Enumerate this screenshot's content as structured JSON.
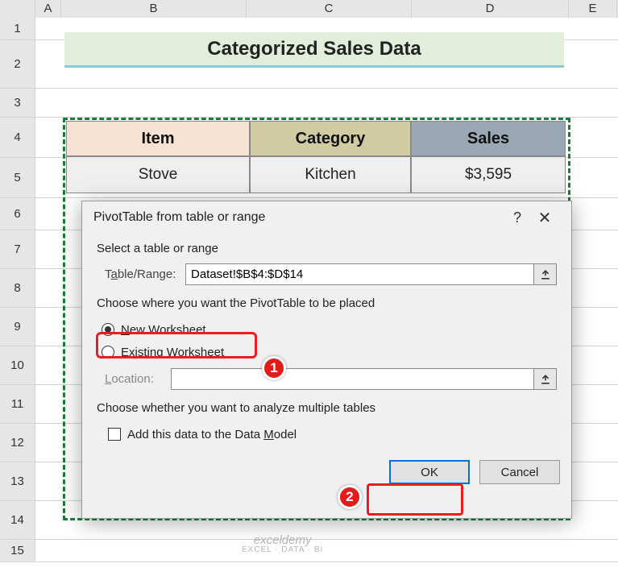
{
  "columns": {
    "A": "A",
    "B": "B",
    "C": "C",
    "D": "D",
    "E": "E"
  },
  "rows": [
    "1",
    "2",
    "3",
    "4",
    "5",
    "6",
    "7",
    "8",
    "9",
    "10",
    "11",
    "12",
    "13",
    "14",
    "15"
  ],
  "title": "Categorized Sales Data",
  "table": {
    "headers": {
      "item": "Item",
      "category": "Category",
      "sales": "Sales"
    },
    "rows": [
      {
        "item": "Stove",
        "category": "Kitchen",
        "sales": "$3,595"
      }
    ]
  },
  "dialog": {
    "title": "PivotTable from table or range",
    "help": "?",
    "close": "✕",
    "section_select": "Select a table or range",
    "range_label_pre": "T",
    "range_label_ul": "a",
    "range_label_post": "ble/Range:",
    "range_value": "Dataset!$B$4:$D$14",
    "section_place": "Choose where you want the PivotTable to be placed",
    "radio_new_pre": "",
    "radio_new_ul": "N",
    "radio_new_post": "ew Worksheet",
    "radio_exist_pre": "",
    "radio_exist_ul": "E",
    "radio_exist_post": "xisting Worksheet",
    "location_label_pre": "",
    "location_label_ul": "L",
    "location_label_post": "ocation:",
    "location_value": "",
    "section_multi": "Choose whether you want to analyze multiple tables",
    "checkbox_pre": "Add this data to the Data ",
    "checkbox_ul": "M",
    "checkbox_post": "odel",
    "ok": "OK",
    "cancel": "Cancel"
  },
  "callouts": {
    "one": "1",
    "two": "2"
  },
  "watermark": {
    "line1": "exceldemy",
    "line2": "EXCEL · DATA · BI"
  }
}
